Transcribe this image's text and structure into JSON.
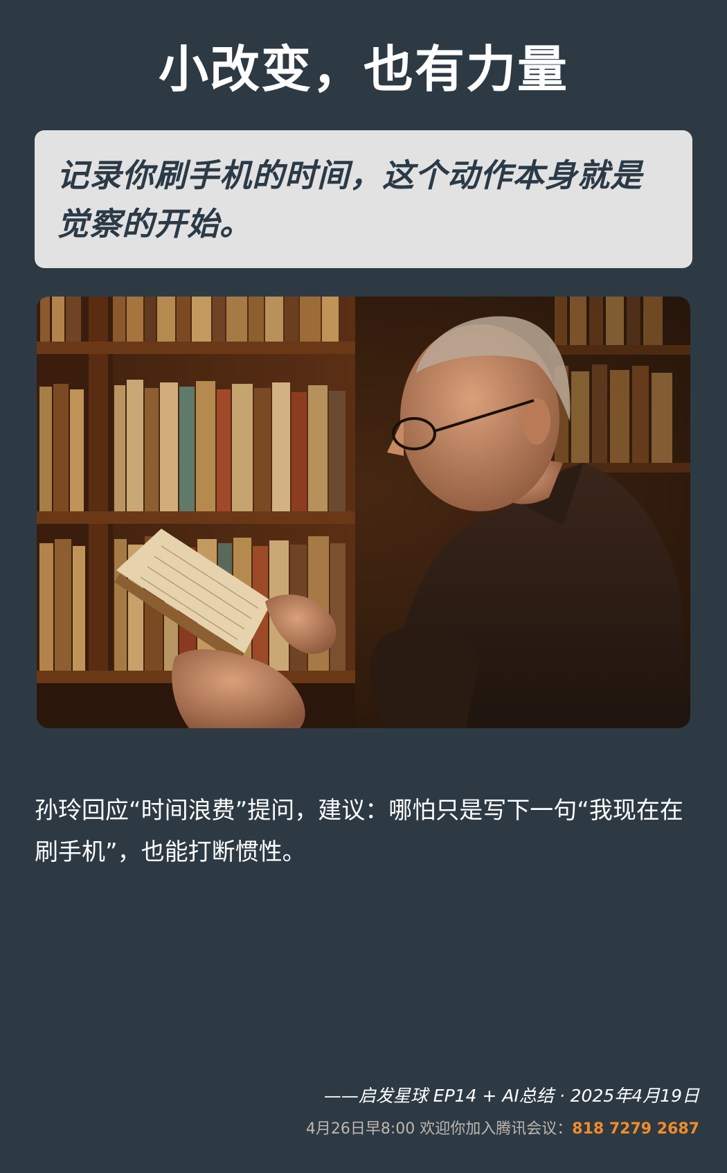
{
  "title": "小改变，也有力量",
  "quote": "记录你刷手机的时间，这个动作本身就是觉察的开始。",
  "image": {
    "description": "older man with glasses reading a book in front of library bookshelves",
    "icon": "photo-illustration"
  },
  "caption": "孙玲回应“时间浪费”提问，建议：哪怕只是写下一句“我现在在刷手机”，也能打断惯性。",
  "footer": {
    "credit": "——启发星球 EP14 + AI总结 · 2025年4月19日",
    "invite_text": "4月26日早8:00 欢迎你加入腾讯会议：",
    "meeting_number": "818 7279 2687"
  },
  "colors": {
    "background": "#2d3a44",
    "card": "#e2e2e2",
    "quote_text": "#2b3a47",
    "accent": "#f28c2a"
  }
}
